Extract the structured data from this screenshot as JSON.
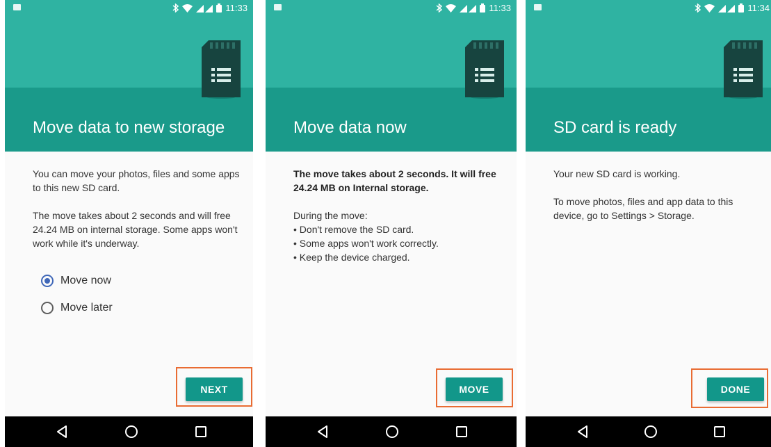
{
  "colors": {
    "header_top": "#2fb3a2",
    "header_bottom": "#1a9a8a",
    "button": "#12978a",
    "radio_selected": "#3f67b8",
    "highlight_border": "#e96c33"
  },
  "screens": [
    {
      "status": {
        "time": "11:33"
      },
      "title": "Move data to new storage",
      "paragraphs": [
        "You can move your photos, files and some apps to this new SD card.",
        "The move takes about 2 seconds and will free 24.24 MB on internal storage. Some apps won't work while it's underway."
      ],
      "options": [
        {
          "label": "Move now",
          "selected": true
        },
        {
          "label": "Move later",
          "selected": false
        }
      ],
      "button": "NEXT"
    },
    {
      "status": {
        "time": "11:33"
      },
      "title": "Move data now",
      "bold_text": "The move takes about 2 seconds. It will free 24.24 MB on Internal storage.",
      "during_label": "During the move:",
      "bullets": [
        "• Don't remove the SD card.",
        "• Some apps won't work correctly.",
        "• Keep the device charged."
      ],
      "button": "MOVE"
    },
    {
      "status": {
        "time": "11:34"
      },
      "title": "SD card is ready",
      "paragraphs": [
        "Your new SD card is working.",
        "To move photos, files and app data to this device, go to Settings > Storage."
      ],
      "button": "DONE"
    }
  ],
  "icons": [
    "image-notification-icon",
    "bluetooth-icon",
    "wifi-icon",
    "signal-icon",
    "battery-icon",
    "sd-card-icon",
    "back-icon",
    "home-icon",
    "recents-icon"
  ]
}
